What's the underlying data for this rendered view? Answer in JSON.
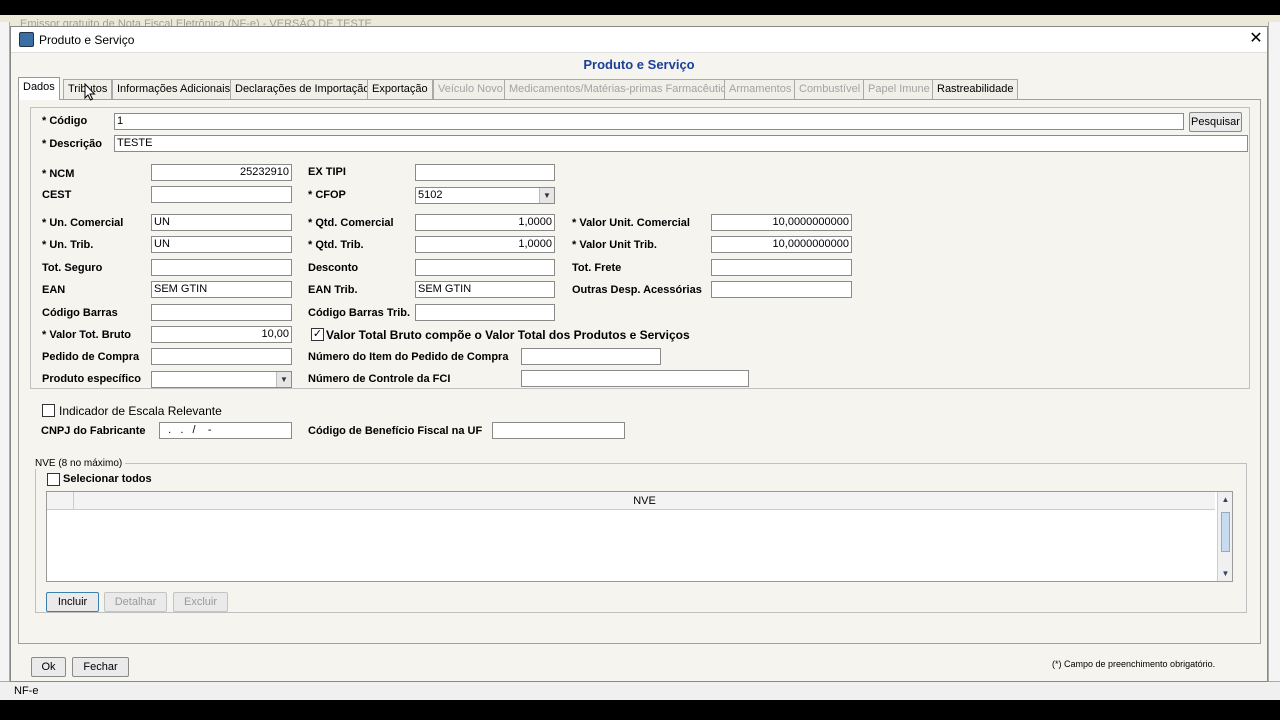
{
  "background": {
    "title_ghost": "Emissor gratuito de Nota Fiscal Eletrônica (NF-e) - VERSÃO DE TESTE"
  },
  "statusbar": {
    "text": "NF-e"
  },
  "dialog": {
    "title": "Produto e Serviço",
    "close_glyph": "✕",
    "header": "Produto e Serviço",
    "tabs": [
      {
        "label": "Dados",
        "active": true,
        "enabled": true
      },
      {
        "label": "Tributos",
        "enabled": true
      },
      {
        "label": "Informações Adicionais",
        "enabled": true
      },
      {
        "label": "Declarações de Importação",
        "enabled": true
      },
      {
        "label": "Exportação",
        "enabled": true
      },
      {
        "label": "Veículo Novo",
        "enabled": false
      },
      {
        "label": "Medicamentos/Matérias-primas Farmacêuticas",
        "enabled": false
      },
      {
        "label": "Armamentos",
        "enabled": false
      },
      {
        "label": "Combustível",
        "enabled": false
      },
      {
        "label": "Papel Imune",
        "enabled": false
      },
      {
        "label": "Rastreabilidade",
        "enabled": true
      }
    ]
  },
  "form": {
    "codigo": {
      "label": "* Código",
      "value": "1"
    },
    "pesquisar_label": "Pesquisar",
    "descricao": {
      "label": "* Descrição",
      "value": "TESTE"
    },
    "ncm": {
      "label": "* NCM",
      "value": "25232910"
    },
    "ex_tipi": {
      "label": "EX TIPI",
      "value": ""
    },
    "cest": {
      "label": "CEST",
      "value": ""
    },
    "cfop": {
      "label": "* CFOP",
      "value": "5102"
    },
    "un_comercial": {
      "label": "* Un. Comercial",
      "value": "UN"
    },
    "qtd_comercial": {
      "label": "* Qtd. Comercial",
      "value": "1,0000"
    },
    "valor_unit_comercial": {
      "label": "* Valor Unit. Comercial",
      "value": "10,0000000000"
    },
    "un_trib": {
      "label": "* Un. Trib.",
      "value": "UN"
    },
    "qtd_trib": {
      "label": "* Qtd. Trib.",
      "value": "1,0000"
    },
    "valor_unit_trib": {
      "label": "* Valor Unit Trib.",
      "value": "10,0000000000"
    },
    "tot_seguro": {
      "label": "Tot. Seguro",
      "value": ""
    },
    "desconto": {
      "label": "Desconto",
      "value": ""
    },
    "tot_frete": {
      "label": "Tot. Frete",
      "value": ""
    },
    "ean": {
      "label": "EAN",
      "value": "SEM GTIN"
    },
    "ean_trib": {
      "label": "EAN Trib.",
      "value": "SEM GTIN"
    },
    "outras_desp": {
      "label": "Outras Desp. Acessórias",
      "value": ""
    },
    "codigo_barras": {
      "label": "Código Barras",
      "value": ""
    },
    "codigo_barras_trib": {
      "label": "Código Barras Trib.",
      "value": ""
    },
    "valor_tot_bruto": {
      "label": "* Valor Tot. Bruto",
      "value": "10,00"
    },
    "valor_total_compoe": {
      "label": "Valor Total Bruto compõe o Valor Total dos Produtos e Serviços",
      "checked": true
    },
    "pedido_compra": {
      "label": "Pedido de Compra",
      "value": ""
    },
    "numero_item_pedido": {
      "label": "Número do Item do Pedido de Compra",
      "value": ""
    },
    "produto_especifico": {
      "label": "Produto específico",
      "value": ""
    },
    "numero_controle_fci": {
      "label": "Número de Controle da FCI",
      "value": ""
    },
    "indicador_escala": {
      "label": "Indicador de Escala Relevante",
      "checked": false
    },
    "cnpj_fabricante": {
      "label": "CNPJ do Fabricante",
      "value": "  .   .   /    -  "
    },
    "codigo_beneficio": {
      "label": "Código de Benefício Fiscal na UF",
      "value": ""
    }
  },
  "nve": {
    "legend": "NVE (8 no máximo)",
    "select_all_label": "Selecionar todos",
    "column_header": "NVE",
    "buttons": {
      "incluir": "Incluir",
      "detalhar": "Detalhar",
      "excluir": "Excluir"
    }
  },
  "footer": {
    "ok_label": "Ok",
    "fechar_label": "Fechar",
    "footnote": "(*) Campo de preenchimento obrigatório."
  },
  "icons": {
    "checkmark": "✓",
    "combo_arrow": "▼",
    "scroll_up": "▲",
    "scroll_down": "▼"
  }
}
